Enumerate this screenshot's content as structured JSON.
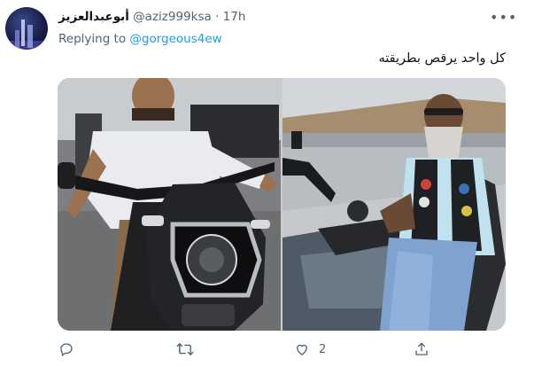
{
  "tweet": {
    "display_name": "أبوعبدالعزيز",
    "handle": "@aziz999ksa",
    "separator": "·",
    "time": "17h",
    "replying_label": "Replying to",
    "replying_to": "@gorgeous4ew",
    "text": "كل واحد يرقص بطريقته",
    "more_icon": "more-icon"
  },
  "media": {
    "left_photo": "man-on-motorcycle-photo",
    "right_photo": "bearded-biker-photo"
  },
  "actions": {
    "reply_count": "",
    "retweet_count": "",
    "like_count": "2",
    "share_count": ""
  },
  "colors": {
    "accent": "#1d9bf0",
    "secondary_text": "#536471",
    "primary_text": "#0f1419"
  }
}
